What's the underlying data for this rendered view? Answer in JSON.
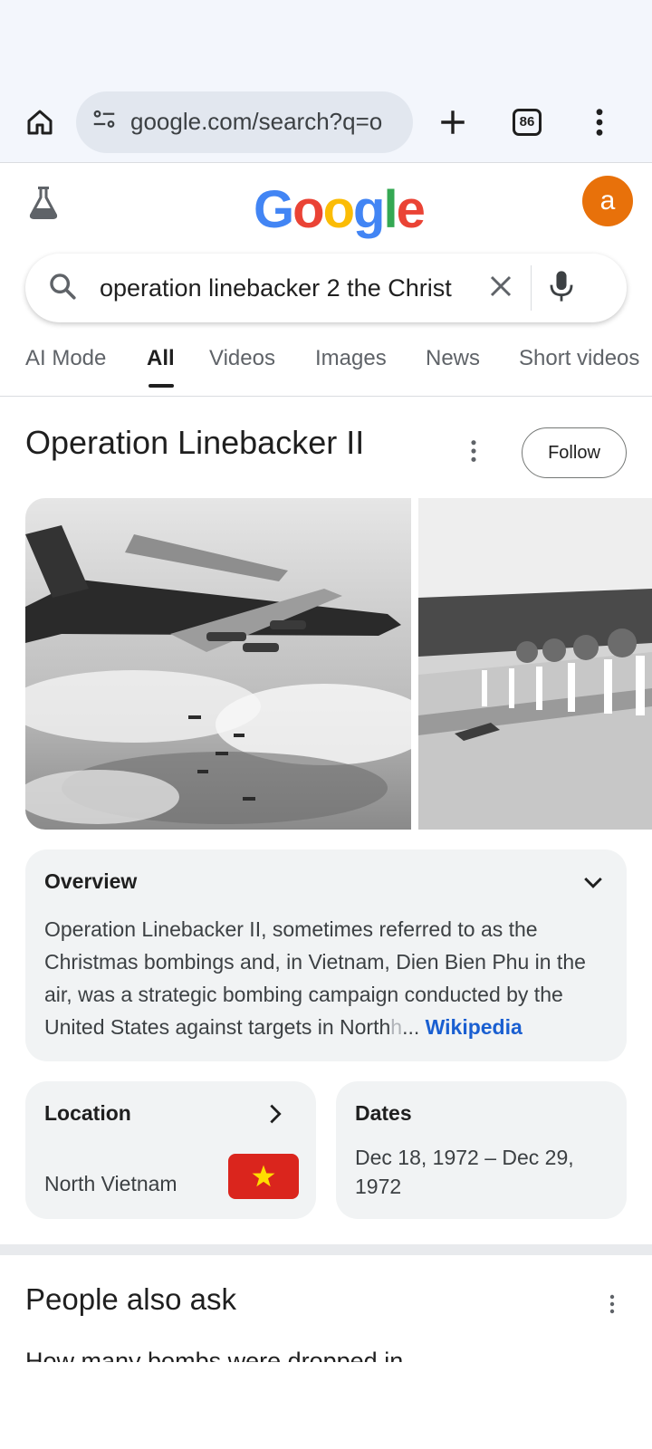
{
  "browser": {
    "url": "google.com/search?q=o",
    "tab_count": "86"
  },
  "google": {
    "logo_letters": [
      "G",
      "o",
      "o",
      "g",
      "l",
      "e"
    ],
    "avatar_letter": "a"
  },
  "search": {
    "query": "operation linebacker 2 the Christ"
  },
  "tabs": [
    {
      "label": "AI Mode"
    },
    {
      "label": "All"
    },
    {
      "label": "Videos"
    },
    {
      "label": "Images"
    },
    {
      "label": "News"
    },
    {
      "label": "Short videos"
    }
  ],
  "knowledge_panel": {
    "title": "Operation Linebacker II",
    "follow_label": "Follow",
    "overview": {
      "heading": "Overview",
      "text": "Operation Linebacker II, sometimes referred to as the Christmas bombings and, in Vietnam, Dien Bien Phu in the air, was a strategic bombing campaign conducted by the United States against targets in North",
      "fade_text": "h",
      "ellipsis": "...",
      "source": "Wikipedia"
    },
    "location": {
      "label": "Location",
      "value": "North Vietnam"
    },
    "dates": {
      "label": "Dates",
      "value": "Dec 18, 1972 – Dec 29, 1972"
    }
  },
  "people_also_ask": {
    "heading": "People also ask",
    "first_question": "How many bombs were dropped in"
  },
  "colors": {
    "accent_blue": "#1a5fd1",
    "avatar_orange": "#e8710a",
    "flag_red": "#da251d",
    "flag_star": "#ffdd00"
  }
}
